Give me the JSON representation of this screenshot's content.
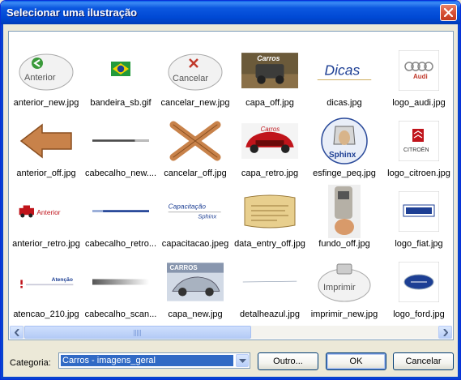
{
  "window": {
    "title": "Selecionar uma ilustração"
  },
  "items": [
    {
      "label": "anterior_new.jpg",
      "icon": "anterior-new"
    },
    {
      "label": "bandeira_sb.gif",
      "icon": "flag-brazil"
    },
    {
      "label": "cancelar_new.jpg",
      "icon": "cancelar-new"
    },
    {
      "label": "capa_off.jpg",
      "icon": "carros-jeep"
    },
    {
      "label": "dicas.jpg",
      "icon": "dicas"
    },
    {
      "label": "logo_audi.jpg",
      "icon": "audi-logo"
    },
    {
      "label": "anterior_off.jpg",
      "icon": "arrow-wood-left"
    },
    {
      "label": "cabecalho_new....",
      "icon": "header-line-gray"
    },
    {
      "label": "cancelar_off.jpg",
      "icon": "wood-x"
    },
    {
      "label": "capa_retro.jpg",
      "icon": "red-retro-car"
    },
    {
      "label": "esfinge_peq.jpg",
      "icon": "sphinx"
    },
    {
      "label": "logo_citroen.jpg",
      "icon": "citroen-logo"
    },
    {
      "label": "anterior_retro.jpg",
      "icon": "retro-car-anterior"
    },
    {
      "label": "cabecalho_retro...",
      "icon": "header-line-blue"
    },
    {
      "label": "capacitacao.jpeg",
      "icon": "capacitacao-sphinx"
    },
    {
      "label": "data_entry_off.jpg",
      "icon": "parchment"
    },
    {
      "label": "fundo_off.jpg",
      "icon": "payphone"
    },
    {
      "label": "logo_fiat.jpg",
      "icon": "fiat-logo"
    },
    {
      "label": "atencao_210.jpg",
      "icon": "atencao-bar"
    },
    {
      "label": "cabecalho_scan...",
      "icon": "gradient-bar"
    },
    {
      "label": "capa_new.jpg",
      "icon": "carros-porsche"
    },
    {
      "label": "detalheazul.jpg",
      "icon": "thin-line"
    },
    {
      "label": "imprimir_new.jpg",
      "icon": "imprimir-button"
    },
    {
      "label": "logo_ford.jpg",
      "icon": "ford-logo"
    }
  ],
  "thumb_text": {
    "anterior": "Anterior",
    "cancelar": "Cancelar",
    "carros": "Carros",
    "carros_caps": "CARROS",
    "dicas": "Dicas",
    "audi": "Audi",
    "sphinx": "Sphinx",
    "citroen": "CITROËN",
    "capacitacao": "Capacitação",
    "sphinx_small": "Sphinx",
    "atencao": "Atenção",
    "imprimir": "Imprimir"
  },
  "footer": {
    "category_label": "Categoria:",
    "category_value": "Carros - imagens_geral",
    "other_button": "Outro...",
    "ok_button": "OK",
    "cancel_button": "Cancelar"
  },
  "colors": {
    "titlebar": "#0049d4",
    "selection": "#316ac5",
    "window_bg": "#ece9d8"
  }
}
